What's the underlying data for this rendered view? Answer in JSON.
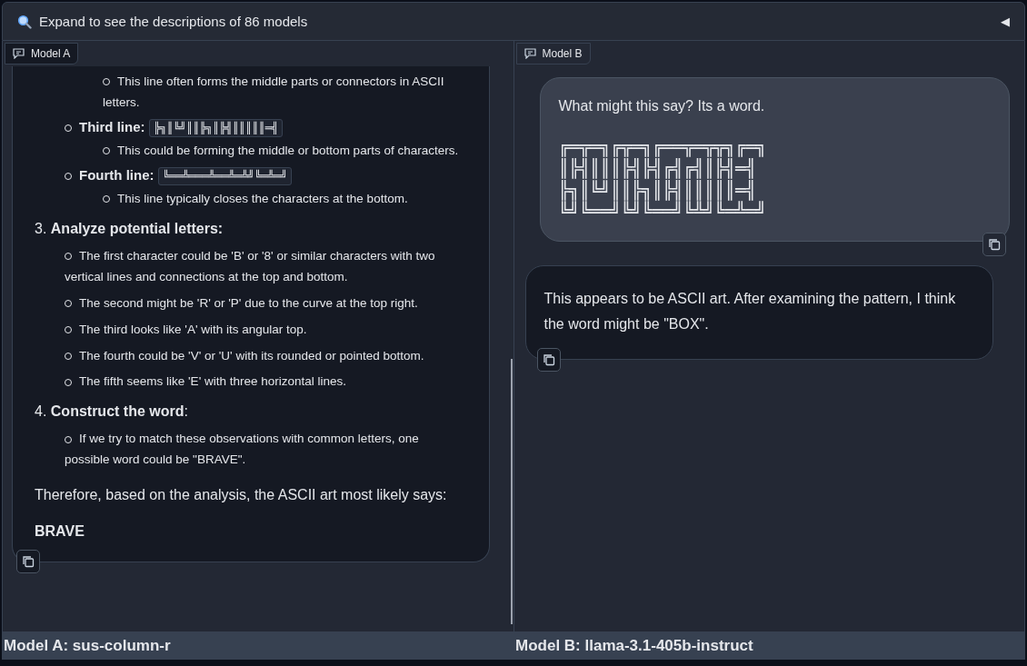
{
  "header": {
    "title": "Expand to see the descriptions of 86 models",
    "toggle": "◀"
  },
  "panels": [
    {
      "tab": "Model A",
      "messages": [
        {
          "kind": "assistant",
          "blocks": [
            {
              "kind": "list",
              "items": [
                {
                  "children": [
                    {
                      "text": "This line often forms the middle parts or connectors in ASCII letters."
                    }
                  ]
                },
                {
                  "label": "Third line:",
                  "code": "╠╗║╚╝║║╠╗║╠╣║║║║║═╣",
                  "children": [
                    {
                      "text": "This could be forming the middle or bottom parts of characters."
                    }
                  ]
                },
                {
                  "label": "Fourth line:",
                  "code": "╚══╩═══╩══╩═╩╝╚═╩═╝",
                  "children": [
                    {
                      "text": "This line typically closes the characters at the bottom."
                    }
                  ]
                }
              ]
            },
            {
              "kind": "heading",
              "number": "3.",
              "text": "**Analyze potential letters:**"
            },
            {
              "kind": "list",
              "items": [
                {
                  "text": "The first character could be 'B' or '8' or similar characters with two vertical lines and connections at the top and bottom."
                },
                {
                  "text": "The second might be 'R' or 'P' due to the curve at the top right."
                },
                {
                  "text": "The third looks like 'A' with its angular top."
                },
                {
                  "text": "The fourth could be 'V' or 'U' with its rounded or pointed bottom."
                },
                {
                  "text": "The fifth seems like 'E' with three horizontal lines."
                }
              ]
            },
            {
              "kind": "heading",
              "number": "4.",
              "text": "**Construct the word**:"
            },
            {
              "kind": "list",
              "items": [
                {
                  "text": "If we try to match these observations with common letters, one possible word could be \"BRAVE\"."
                }
              ]
            },
            {
              "kind": "paragraph",
              "text": "Therefore, based on the analysis, the ASCII art most likely says:"
            },
            {
              "kind": "strong",
              "text": "BRAVE"
            }
          ]
        }
      ]
    },
    {
      "tab": "Model B",
      "messages": [
        {
          "kind": "user",
          "blocks": [
            {
              "kind": "paragraph",
              "text": "What might this say? Its a word."
            },
            {
              "kind": "art",
              "lines": [
                "╔═╦═╗╔╦═╗╔══╦═╦╦╗╔═╗",
                "║╠╣║║║╠╣╠╣╔╣╔╣║╠╣═╣",
                "╠╗║╚╝║║╠╗║╠╣║║║║║═╣",
                "╚╝╚══╝╚╝╚══╝╚╩╝╚═╩═╝"
              ]
            }
          ]
        },
        {
          "kind": "assistant",
          "blocks": [
            {
              "kind": "paragraph",
              "text": "This appears to be ASCII art. After examining the pattern, I think the word might be \"BOX\"."
            }
          ]
        }
      ]
    }
  ],
  "footer": [
    "Model A: sus-column-r",
    "Model B: llama-3.1-405b-instruct"
  ]
}
